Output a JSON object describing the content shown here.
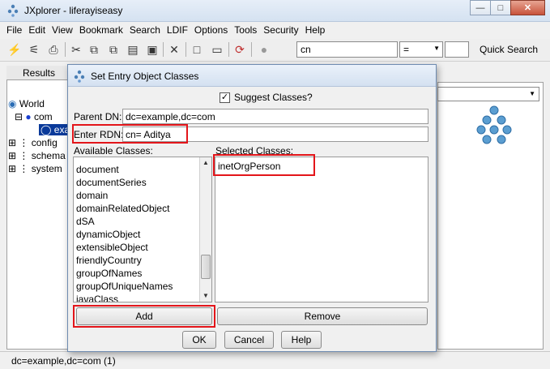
{
  "window": {
    "title": "JXplorer - liferayiseasy"
  },
  "menu": [
    "File",
    "Edit",
    "View",
    "Bookmark",
    "Search",
    "LDIF",
    "Options",
    "Tools",
    "Security",
    "Help"
  ],
  "toolbar": {
    "search_attribute": "cn",
    "search_operator": "=",
    "search_value": "",
    "quick_search_label": "Quick Search"
  },
  "left_panel": {
    "tab_label": "Results",
    "tree": [
      "World",
      "com",
      "exa",
      "config",
      "schema",
      "system"
    ]
  },
  "dialog": {
    "title": "Set Entry Object Classes",
    "suggest_label": "Suggest Classes?",
    "suggest_checked": true,
    "parent_dn_label": "Parent DN:",
    "parent_dn_value": "dc=example,dc=com",
    "rdn_label": "Enter RDN:",
    "rdn_value": "cn= Aditya",
    "available_label": "Available Classes:",
    "available_classes": [
      "document",
      "documentSeries",
      "domain",
      "domainRelatedObject",
      "dSA",
      "dynamicObject",
      "extensibleObject",
      "friendlyCountry",
      "groupOfNames",
      "groupOfUniqueNames",
      "javaClass"
    ],
    "selected_label": "Selected Classes:",
    "selected_classes": [
      "inetOrgPerson"
    ],
    "add_label": "Add",
    "remove_label": "Remove",
    "ok_label": "OK",
    "cancel_label": "Cancel",
    "help_label": "Help"
  },
  "status": {
    "text": "dc=example,dc=com (1)"
  },
  "colors": {
    "highlight": "#e3151a",
    "titlebar": "#d5e2f1"
  }
}
